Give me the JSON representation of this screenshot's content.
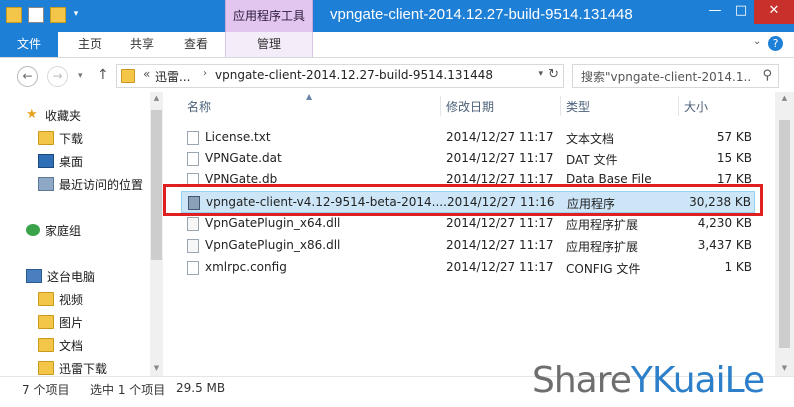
{
  "window": {
    "title": "vpngate-client-2014.12.27-build-9514.131448",
    "context_tab": "应用程序工具",
    "controls": {
      "minimize": "—",
      "maximize": "□",
      "close": "✕"
    }
  },
  "ribbon": {
    "tabs": [
      "文件",
      "主页",
      "共享",
      "查看",
      "管理"
    ]
  },
  "address": {
    "overflow": "«",
    "crumbs": [
      "迅雷...",
      "vpngate-client-2014.12.27-build-9514.131448"
    ],
    "search_placeholder": "搜索\"vpngate-client-2014.1...",
    "back_icon": "←",
    "forward_icon": "→",
    "up_icon": "↑",
    "refresh_icon": "↻",
    "search_icon": "⚲"
  },
  "nav": {
    "items": [
      {
        "label": "收藏夹",
        "icon": "star-icon"
      },
      {
        "label": "下载",
        "icon": "downloads-icon"
      },
      {
        "label": "桌面",
        "icon": "desktop-icon"
      },
      {
        "label": "最近访问的位置",
        "icon": "recent-icon"
      },
      {
        "label": "家庭组",
        "icon": "homegroup-icon"
      },
      {
        "label": "这台电脑",
        "icon": "computer-icon"
      },
      {
        "label": "视频",
        "icon": "videos-icon"
      },
      {
        "label": "图片",
        "icon": "pictures-icon"
      },
      {
        "label": "文档",
        "icon": "documents-icon"
      },
      {
        "label": "迅雷下载",
        "icon": "folder-icon"
      }
    ]
  },
  "columns": {
    "name": "名称",
    "date": "修改日期",
    "type": "类型",
    "size": "大小"
  },
  "files": [
    {
      "name": "License.txt",
      "date": "2014/12/27 11:17",
      "type": "文本文档",
      "size": "57 KB",
      "kind": "txt"
    },
    {
      "name": "VPNGate.dat",
      "date": "2014/12/27 11:17",
      "type": "DAT 文件",
      "size": "15 KB",
      "kind": "dat"
    },
    {
      "name": "VPNGate.db",
      "date": "2014/12/27 11:17",
      "type": "Data Base File",
      "size": "17 KB",
      "kind": "db"
    },
    {
      "name": "vpngate-client-v4.12-9514-beta-2014....",
      "date": "2014/12/27 11:16",
      "type": "应用程序",
      "size": "30,238 KB",
      "kind": "exe"
    },
    {
      "name": "VpnGatePlugin_x64.dll",
      "date": "2014/12/27 11:17",
      "type": "应用程序扩展",
      "size": "4,230 KB",
      "kind": "dll"
    },
    {
      "name": "VpnGatePlugin_x86.dll",
      "date": "2014/12/27 11:17",
      "type": "应用程序扩展",
      "size": "3,437 KB",
      "kind": "dll"
    },
    {
      "name": "xmlrpc.config",
      "date": "2014/12/27 11:17",
      "type": "CONFIG 文件",
      "size": "1 KB",
      "kind": "config"
    }
  ],
  "status": {
    "count": "7 个项目",
    "selected": "选中 1 个项目",
    "size": "29.5 MB"
  },
  "watermark": {
    "part1": "Share",
    "part2": "YKuaiLe"
  },
  "colors": {
    "accent": "#1e7fd6",
    "context_tab": "#e2c6ef",
    "selection": "#cde6f7",
    "highlight": "#e02020"
  }
}
